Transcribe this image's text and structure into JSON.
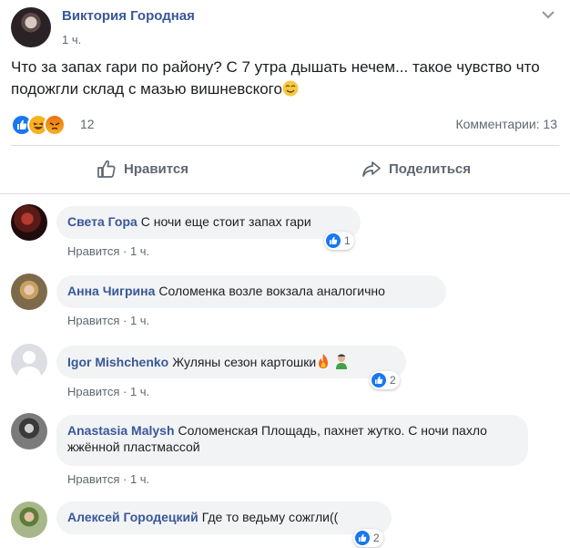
{
  "post": {
    "author": "Виктория Городная",
    "time": "1 ч.",
    "text": "Что за запах гари по району? С 7 утра дышать нечем... такое чувство что подожгли склад с мазью вишневского",
    "reactions_count": "12",
    "comments_label": "Комментарии: 13"
  },
  "actions": {
    "like_label": "Нравится",
    "share_label": "Поделиться"
  },
  "comments": [
    {
      "author": "Света Гора",
      "text": "С ночи еще стоит запах гари",
      "like_label": "Нравится",
      "time": "1 ч.",
      "reactions": "1"
    },
    {
      "author": "Анна Чигрина",
      "text": "Соломенка возле вокзала аналогично",
      "like_label": "Нравится",
      "time": "1 ч.",
      "reactions": ""
    },
    {
      "author": "Igor Mishchenko",
      "text": "Жуляны сезон картошки",
      "like_label": "Нравится",
      "time": "1 ч.",
      "reactions": "2"
    },
    {
      "author": "Anastasia Malysh",
      "text": "Соломенская Площадь, пахнет жутко. С ночи пахло жжённой пластмассой",
      "like_label": "Нравится",
      "time": "1 ч.",
      "reactions": ""
    },
    {
      "author": "Алексей Городецкий",
      "text": "Где то ведьму сожгли((",
      "like_label": "",
      "time": "",
      "reactions": "2"
    }
  ],
  "colors": {
    "link": "#385898",
    "like_blue": "#1877f2",
    "bubble": "#f2f3f5",
    "muted": "#606770"
  }
}
